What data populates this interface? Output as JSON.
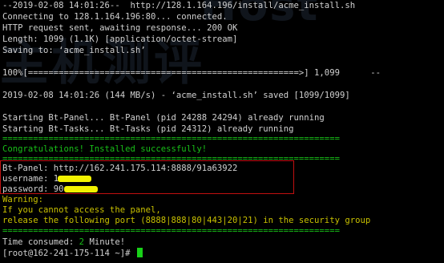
{
  "terminal": {
    "lines": [
      "--2019-02-08 14:01:26--  http://128.1.164.196/install/acme_install.sh",
      "Connecting to 128.1.164.196:80... connected.",
      "HTTP request sent, awaiting response... 200 OK",
      "Length: 1099 (1.1K) [application/octet-stream]",
      "Saving to: ‘acme_install.sh’",
      "",
      "100%[=====================================================>] 1,099      --",
      "",
      "2019-02-08 14:01:26 (144 MB/s) - ‘acme_install.sh’ saved [1099/1099]",
      "",
      "Starting Bt-Panel... Bt-Panel (pid 24288 24294) already running",
      "Starting Bt-Tasks... Bt-Tasks (pid 24312) already running",
      "==================================================================",
      "Congratulations! Installed successfully!",
      "==================================================================",
      "Bt-Panel: http://162.241.175.114:8888/91a63922",
      "username: 1",
      "password: 90",
      "Warning:",
      "If you cannot access the panel,",
      "release the following port (8888|888|80|443|20|21) in the security group",
      "==================================================================",
      "Time consumed: ",
      "2",
      " Minute!",
      "[root@162-241-175-114 ~]# "
    ]
  },
  "colors": {
    "background": "#000000",
    "text": "#c8c8c8",
    "success_green": "#18c018",
    "warning_yellow": "#c8c000",
    "box_border": "#c01010",
    "redaction": "#f2f200"
  }
}
